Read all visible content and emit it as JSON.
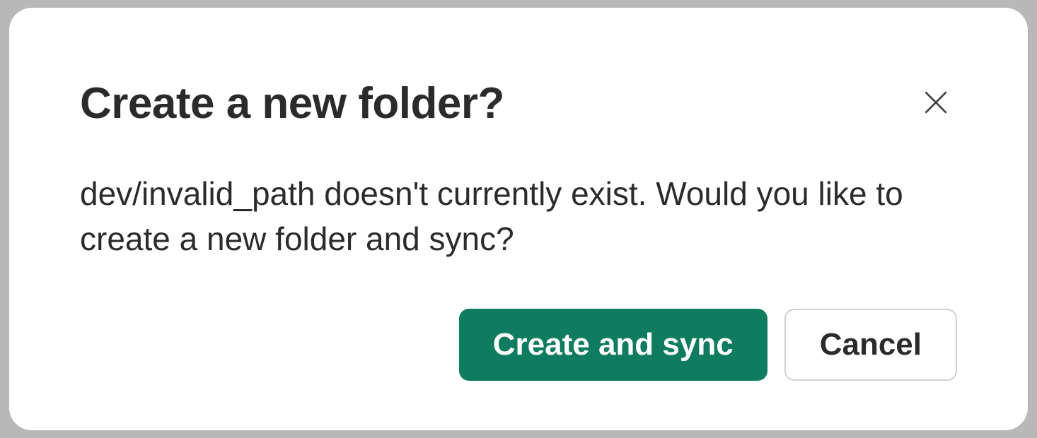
{
  "dialog": {
    "title": "Create a new folder?",
    "body": "dev/invalid_path doesn't currently exist. Would you like to create a new folder and sync?",
    "primary_label": "Create and sync",
    "secondary_label": "Cancel"
  }
}
